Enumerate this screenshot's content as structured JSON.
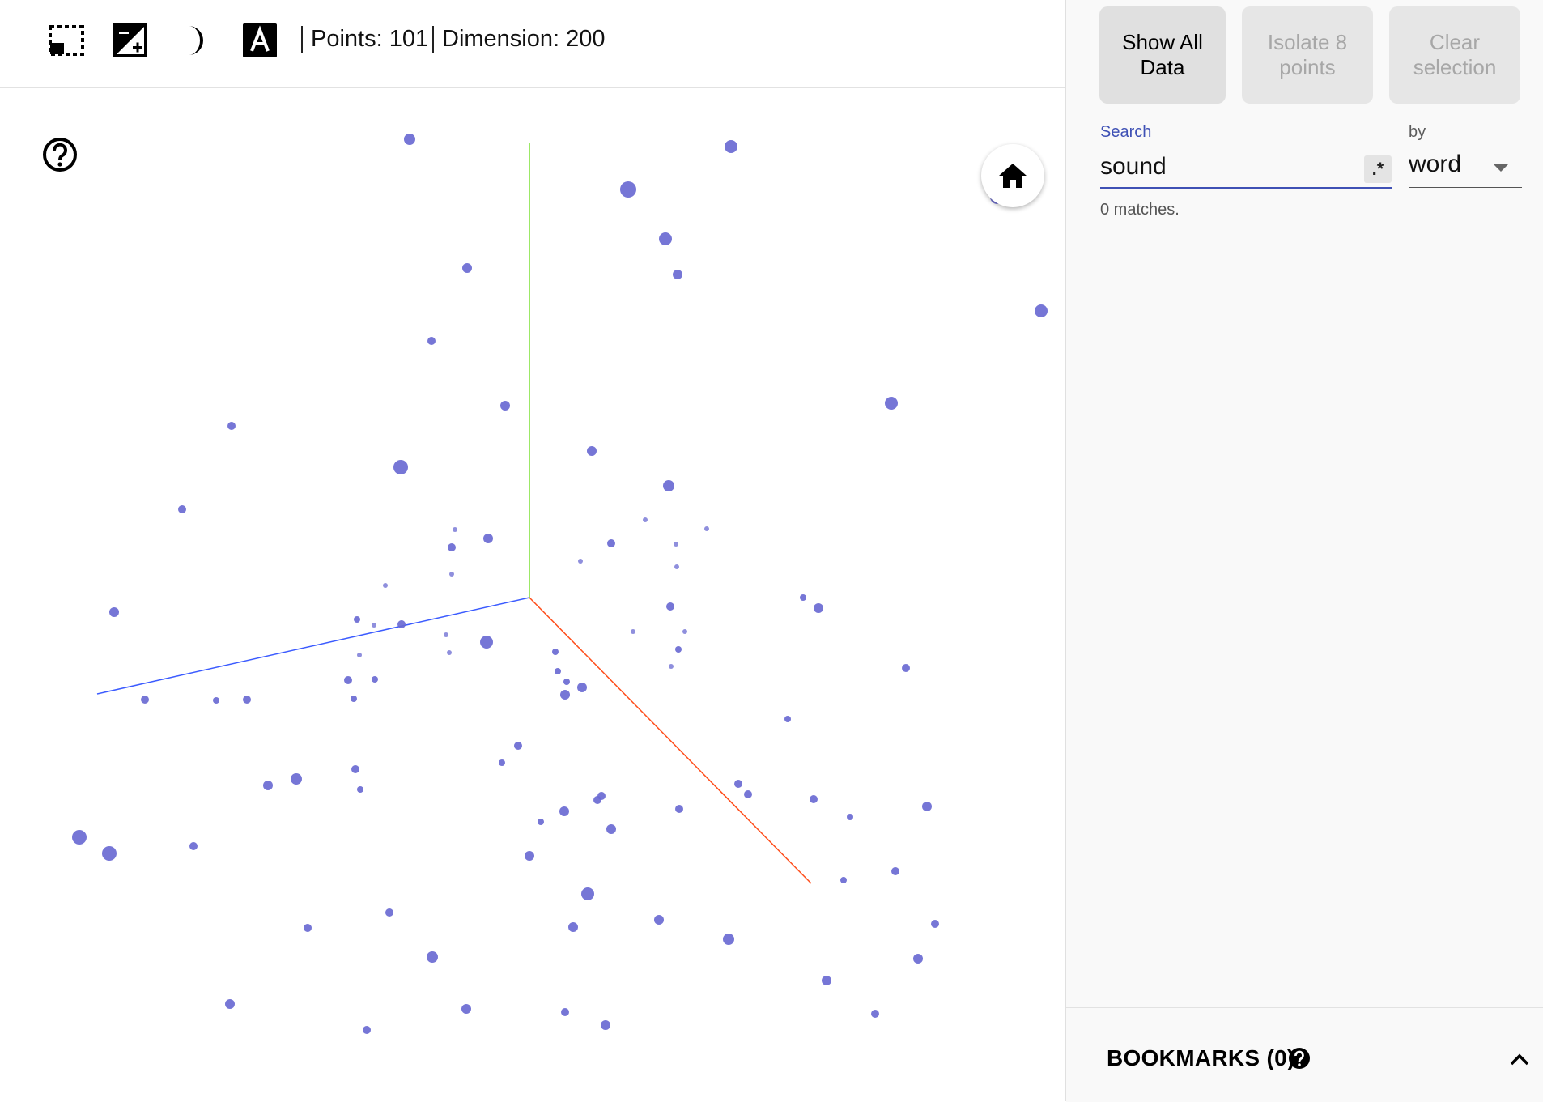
{
  "toolbar": {
    "icons": [
      "selection-rect-icon",
      "night-mode-contrast-icon",
      "crescent-moon-icon",
      "label-a-icon"
    ],
    "points_text": "Points: 101",
    "dimension_text": "Dimension: 200"
  },
  "viewport": {
    "help_icon": "question-circle-icon",
    "home_icon": "home-icon",
    "point_color": "#6a6ad2",
    "axis_colors": {
      "x": "#ff4d1a",
      "y": "#7be034",
      "z": "#3b5bff"
    }
  },
  "panel": {
    "show_all_label": "Show All Data",
    "isolate_label": "Isolate 8 points",
    "clear_label": "Clear selection",
    "search_label": "Search",
    "search_value": "sound",
    "regex_label": ".*",
    "by_label": "by",
    "by_value": "word",
    "matches_text": "0 matches.",
    "bookmarks_title": "BOOKMARKS (0)",
    "accent_color": "#3f51b5"
  }
}
